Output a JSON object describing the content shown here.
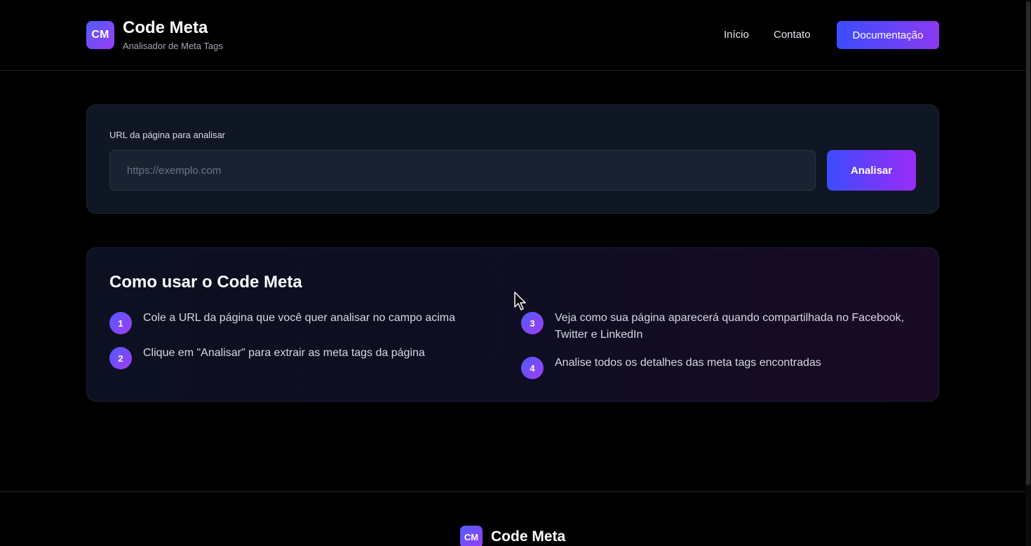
{
  "header": {
    "logo_initials": "CM",
    "title": "Code Meta",
    "subtitle": "Analisador de Meta Tags",
    "nav": {
      "inicio": "Início",
      "contato": "Contato",
      "docs": "Documentação"
    }
  },
  "analyze": {
    "label": "URL da página para analisar",
    "input_placeholder": "https://exemplo.com",
    "input_value": "",
    "button": "Analisar"
  },
  "howto": {
    "title": "Como usar o Code Meta",
    "steps": [
      {
        "num": "1",
        "text": "Cole a URL da página que você quer analisar no campo acima"
      },
      {
        "num": "2",
        "text": "Clique em \"Analisar\" para extrair as meta tags da página"
      },
      {
        "num": "3",
        "text": "Veja como sua página aparecerá quando compartilhada no Facebook, Twitter e LinkedIn"
      },
      {
        "num": "4",
        "text": "Analise todos os detalhes das meta tags encontradas"
      }
    ]
  },
  "footer": {
    "logo_initials": "CM",
    "title": "Code Meta"
  },
  "colors": {
    "background": "#000000",
    "accent_start": "#3d4cff",
    "accent_end": "#9b2cf5",
    "card": "#0f1624"
  }
}
